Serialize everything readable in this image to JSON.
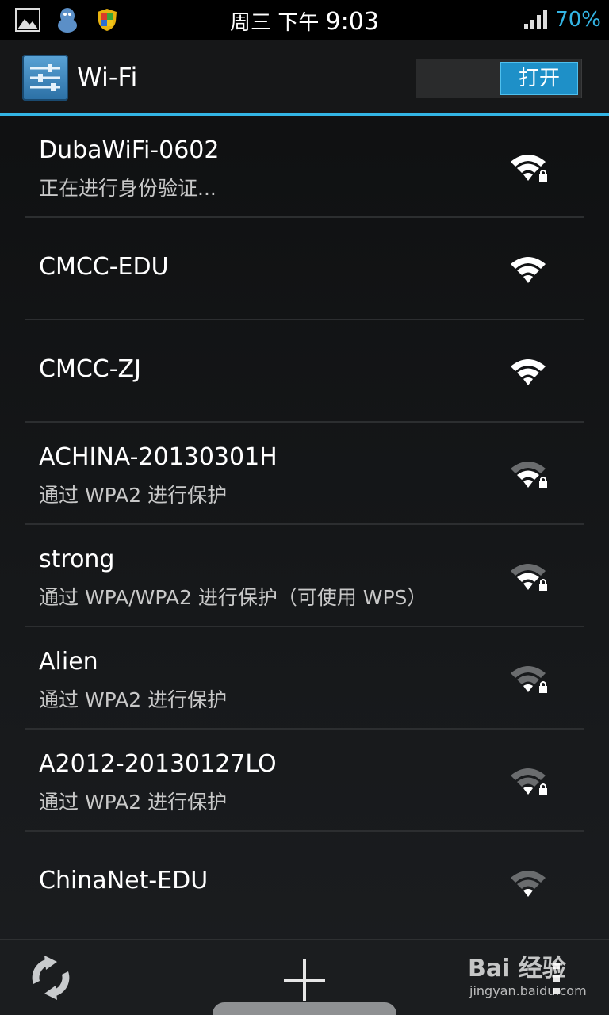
{
  "status_bar": {
    "day": "周三",
    "period": "下午",
    "time": "9:03",
    "battery": "70%",
    "icons": [
      "gallery-icon",
      "qq-penguin-icon",
      "shield-icon",
      "signal-icon"
    ]
  },
  "header": {
    "title": "Wi-Fi",
    "toggle_label": "打开",
    "icon": "settings-sliders-icon",
    "accent": "#33b5e5"
  },
  "networks": [
    {
      "ssid": "DubaWiFi-0602",
      "status": "正在进行身份验证...",
      "secured": true,
      "signal": "full"
    },
    {
      "ssid": "CMCC-EDU",
      "status": "",
      "secured": false,
      "signal": "full"
    },
    {
      "ssid": "CMCC-ZJ",
      "status": "",
      "secured": false,
      "signal": "full"
    },
    {
      "ssid": "ACHINA-20130301H",
      "status": "通过 WPA2 进行保护",
      "secured": true,
      "signal": "medium"
    },
    {
      "ssid": "strong",
      "status": "通过 WPA/WPA2 进行保护（可使用 WPS）",
      "secured": true,
      "signal": "medium"
    },
    {
      "ssid": "Alien",
      "status": "通过 WPA2 进行保护",
      "secured": true,
      "signal": "weak"
    },
    {
      "ssid": "A2012-20130127LO",
      "status": "通过 WPA2 进行保护",
      "secured": true,
      "signal": "weak"
    },
    {
      "ssid": "ChinaNet-EDU",
      "status": "",
      "secured": false,
      "signal": "weak"
    }
  ],
  "bottom_bar": {
    "scan_icon": "refresh-icon",
    "add_icon": "add-network-icon",
    "menu_icon": "overflow-menu-icon"
  },
  "watermark": {
    "brand": "Bai 经验",
    "url": "jingyan.baidu.com"
  }
}
